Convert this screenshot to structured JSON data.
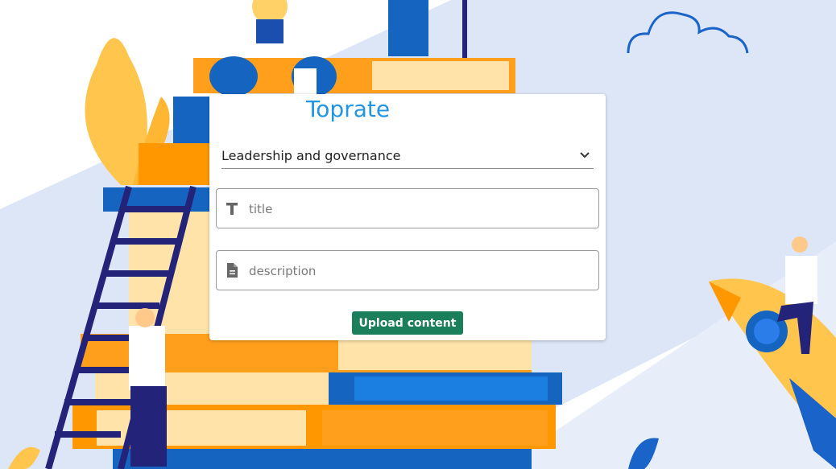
{
  "app": {
    "brand_name": "Toprate"
  },
  "form": {
    "category_select": {
      "selected": "Leadership and governance"
    },
    "title_input": {
      "placeholder": "title",
      "value": ""
    },
    "description_input": {
      "placeholder": "description",
      "value": ""
    },
    "submit_label": "Upload content"
  },
  "icons": {
    "select_arrow": "chevron-down-icon",
    "title_field": "text-format-icon",
    "description_field": "document-icon"
  },
  "colors": {
    "brand_text": "#2196e6",
    "submit_button": "#1a7f5a",
    "illustration_blue": "#1565c0",
    "illustration_orange": "#ff9800",
    "illustration_yellow": "#ffc54d"
  }
}
